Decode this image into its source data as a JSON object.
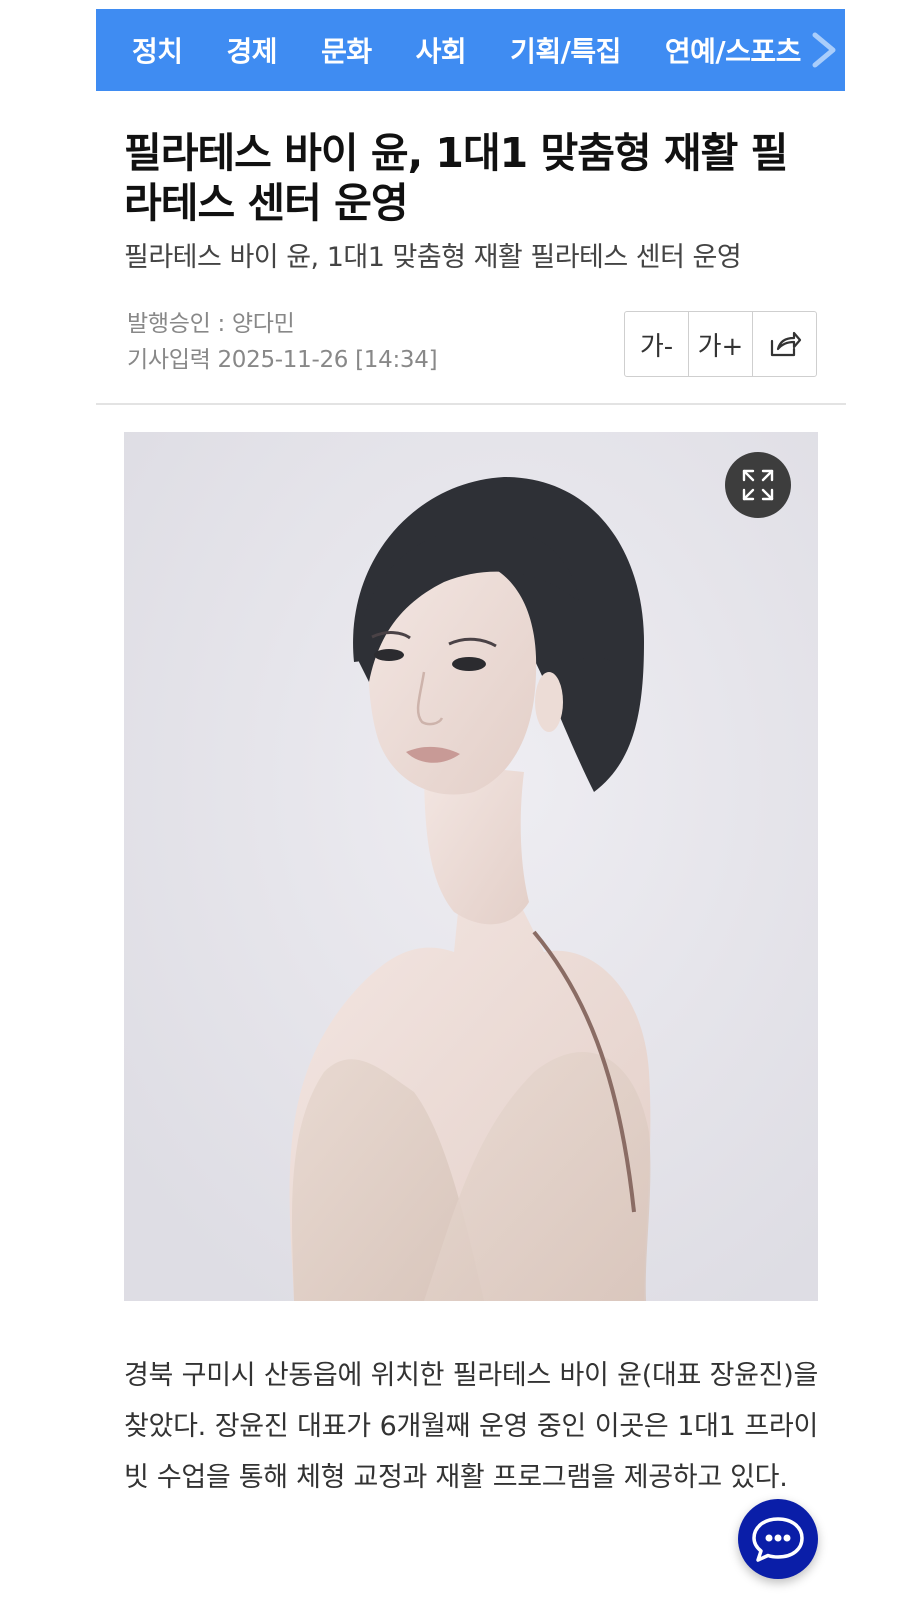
{
  "nav": {
    "items": [
      "정치",
      "경제",
      "문화",
      "사회",
      "기획/특집",
      "연예/스포츠"
    ],
    "next_icon": "chevron-right-icon"
  },
  "article": {
    "title": "필라테스 바이 윤, 1대1 맞춤형 재활 필라테스 센터 운영",
    "subtitle": "필라테스 바이 윤, 1대1 맞춤형 재활 필라테스 센터 운영",
    "publisher_line": "발행승인 : 양다민",
    "date_line": "기사입력 2025-11-26 [14:34]",
    "body": "경북 구미시 산동읍에 위치한 필라테스 바이 윤(대표 장윤진)을 찾았다. 장윤진 대표가 6개월째 운영 중인 이곳은 1대1 프라이빗 수업을 통해 체형 교정과 재활 프로그램을 제공하고 있다."
  },
  "tools": {
    "font_decrease": "가-",
    "font_increase": "가+",
    "share_icon": "share-icon"
  },
  "photo": {
    "expand_icon": "expand-icon"
  },
  "chat": {
    "icon": "chat-bubble-icon"
  },
  "colors": {
    "nav_bg": "#3f8cf2",
    "chat_fab": "#0a1ea8"
  }
}
